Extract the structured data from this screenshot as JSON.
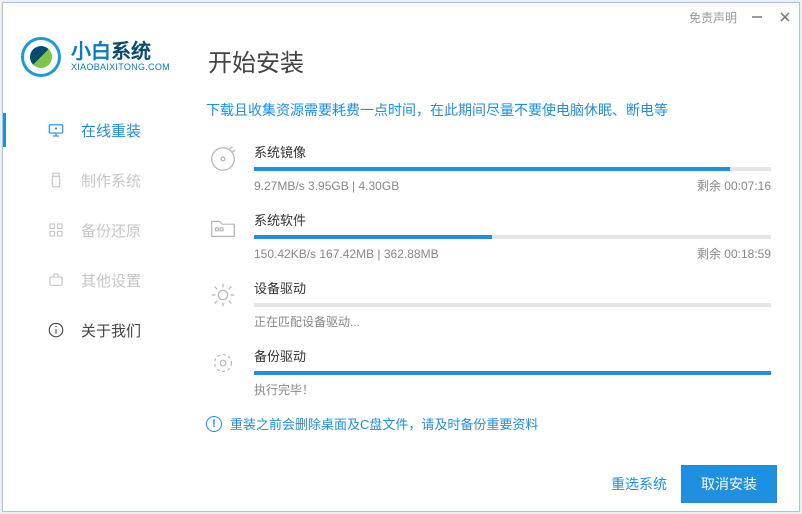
{
  "titlebar": {
    "disclaimer": "免责声明"
  },
  "brand": {
    "cn1": "小白",
    "cn2": "系统",
    "en": "XIAOBAIXITONG.COM"
  },
  "sidebar": {
    "items": [
      {
        "label": "在线重装"
      },
      {
        "label": "制作系统"
      },
      {
        "label": "备份还原"
      },
      {
        "label": "其他设置"
      },
      {
        "label": "关于我们"
      }
    ]
  },
  "page": {
    "title": "开始安装",
    "hint": "下载且收集资源需要耗费一点时间，在此期间尽量不要使电脑休眠、断电等"
  },
  "tasks": [
    {
      "title": "系统镜像",
      "progress_pct": 92,
      "detail": "9.27MB/s 3.95GB | 4.30GB",
      "remain": "剩余 00:07:16"
    },
    {
      "title": "系统软件",
      "progress_pct": 46,
      "detail": "150.42KB/s 167.42MB | 362.88MB",
      "remain": "剩余 00:18:59"
    },
    {
      "title": "设备驱动",
      "progress_pct": 0,
      "detail": "正在匹配设备驱动...",
      "remain": ""
    },
    {
      "title": "备份驱动",
      "progress_pct": 100,
      "detail": "执行完毕！",
      "remain": ""
    }
  ],
  "warning": "重装之前会删除桌面及C盘文件，请及时备份重要资料",
  "footer": {
    "reselect": "重选系统",
    "cancel": "取消安装"
  }
}
